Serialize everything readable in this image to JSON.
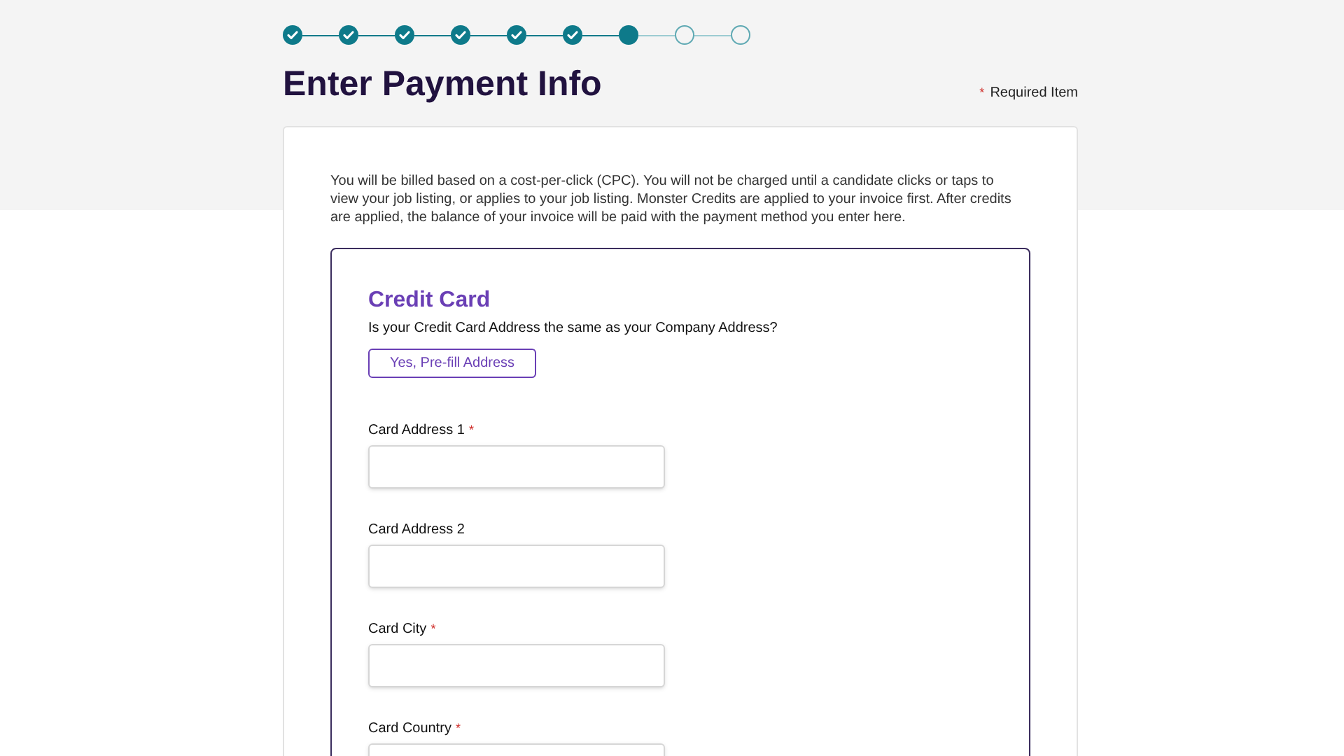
{
  "steps": [
    {
      "kind": "done"
    },
    {
      "kind": "done"
    },
    {
      "kind": "done"
    },
    {
      "kind": "done"
    },
    {
      "kind": "done"
    },
    {
      "kind": "done"
    },
    {
      "kind": "current"
    },
    {
      "kind": "todo"
    },
    {
      "kind": "todo"
    }
  ],
  "title": "Enter Payment Info",
  "required_mark": "*",
  "required_note": "Required Item",
  "intro": "You will be billed based on a cost-per-click (CPC). You will not be charged until a candidate clicks or taps to view your job listing, or applies to your job listing. Monster Credits are applied to your invoice first. After credits are applied, the balance of your invoice will be paid with the payment method you enter here.",
  "section": {
    "title": "Credit Card",
    "question": "Is your Credit Card Address the same as your Company Address?",
    "button": "Yes, Pre-fill Address"
  },
  "fields": [
    {
      "label": "Card Address 1",
      "required": true
    },
    {
      "label": "Card Address 2",
      "required": false
    },
    {
      "label": "Card City",
      "required": true
    },
    {
      "label": "Card Country",
      "required": true
    }
  ]
}
